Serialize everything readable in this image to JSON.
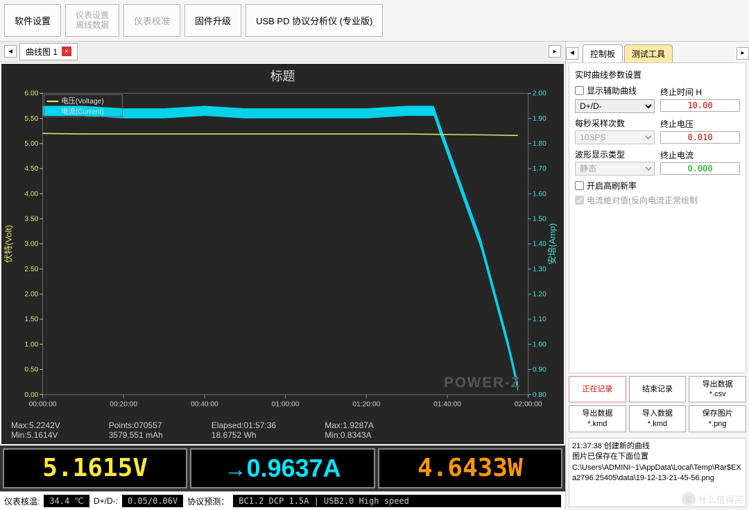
{
  "toolbar": {
    "b1": "软件设置",
    "b2a": "仪表设置",
    "b2b": "离线数据",
    "b3": "仪表校准",
    "b4": "固件升级",
    "b5": "USB PD 协议分析仪 (专业版)"
  },
  "mainTab": {
    "label": "曲线图 1"
  },
  "chart_data": {
    "type": "line",
    "title": "标题",
    "xlabel": "",
    "ylabel_left": "伏特(Volt)",
    "ylabel_right": "安培(Amp)",
    "legend": [
      "电压(Voltage)",
      "电流(Current)"
    ],
    "x_ticks": [
      "00:00:00",
      "00:20:00",
      "00:40:00",
      "01:00:00",
      "01:20:00",
      "01:40:00",
      "02:00:00"
    ],
    "y_left_ticks": [
      0.0,
      0.5,
      1.0,
      1.5,
      2.0,
      2.5,
      3.0,
      3.5,
      4.0,
      4.5,
      5.0,
      5.5,
      6.0
    ],
    "y_right_ticks": [
      0.8,
      0.9,
      1.0,
      1.1,
      1.2,
      1.3,
      1.4,
      1.5,
      1.6,
      1.7,
      1.8,
      1.9,
      2.0
    ],
    "xlim": [
      0,
      7200
    ],
    "ylim_left": [
      0,
      6
    ],
    "ylim_right": [
      0.8,
      2.0
    ],
    "series": [
      {
        "name": "电压(Voltage)",
        "color": "#e0e070",
        "axis": "left",
        "values": [
          [
            0,
            5.2
          ],
          [
            600,
            5.19
          ],
          [
            1200,
            5.19
          ],
          [
            1800,
            5.19
          ],
          [
            2400,
            5.19
          ],
          [
            3000,
            5.19
          ],
          [
            3600,
            5.19
          ],
          [
            4200,
            5.19
          ],
          [
            4800,
            5.19
          ],
          [
            5400,
            5.19
          ],
          [
            6000,
            5.18
          ],
          [
            6600,
            5.17
          ],
          [
            7047,
            5.16
          ]
        ]
      },
      {
        "name": "电流(Current)",
        "color": "#00e5ff",
        "axis": "right",
        "values": [
          [
            0,
            1.93
          ],
          [
            600,
            1.93
          ],
          [
            1200,
            1.92
          ],
          [
            1800,
            1.92
          ],
          [
            2400,
            1.93
          ],
          [
            3000,
            1.92
          ],
          [
            3600,
            1.92
          ],
          [
            4200,
            1.92
          ],
          [
            4800,
            1.92
          ],
          [
            5400,
            1.93
          ],
          [
            5800,
            1.93
          ],
          [
            5900,
            1.85
          ],
          [
            6100,
            1.7
          ],
          [
            6300,
            1.55
          ],
          [
            6500,
            1.4
          ],
          [
            6700,
            1.2
          ],
          [
            6900,
            1.0
          ],
          [
            7047,
            0.83
          ]
        ]
      }
    ],
    "watermark": "POWER-Z"
  },
  "info": {
    "max_v": "Max:5.2242V",
    "min_v": "Min:5.1614V",
    "points": "Points:070557",
    "mah": "3579.551 mAh",
    "elapsed": "Elapsed:01:57:36",
    "wh": "18.6752 Wh",
    "max_a": "Max:1.9287A",
    "min_a": "Min:0.8343A"
  },
  "readout": {
    "voltage": "5.1615V",
    "current": "0.9637A",
    "power": "4.6433W"
  },
  "status": {
    "temp_label": "仪表核温:",
    "temp": "34.4 ℃",
    "dpdm_label": "D+/D-:",
    "dpdm": "0.05/0.06V",
    "proto_label": "协议预测：",
    "proto": "BC1.2 DCP 1.5A | USB2.0 High speed"
  },
  "rightTabs": {
    "t1": "控制板",
    "t2": "测试工具"
  },
  "panel": {
    "heading": "实时曲线参数设置",
    "aux_label": "显示辅助曲线",
    "end_time_label": "终止时间 H",
    "end_time": "10.00",
    "d_sel": "D+/D-",
    "sps_label": "每秒采样次数",
    "sps": "10SPS",
    "endv_label": "终止电压",
    "endv": "0.010",
    "wave_label": "波形显示类型",
    "wave": "静态",
    "enda_label": "终止电流",
    "enda": "0.000",
    "hirate_label": "开启高刷新率",
    "abs_label": "电流绝对值(反向电流正常绘制"
  },
  "buttons": {
    "b1": "正在记录",
    "b2": "结束记录",
    "b3": "导出数据\n*.csv",
    "b4": "导出数据\n*.kmd",
    "b5": "导入数据\n*.kmd",
    "b6": "保存图片\n*.png"
  },
  "log": {
    "l1": "21:37:38 创建新的曲线",
    "l2": "图片已保存在下面位置",
    "l3": "C:\\Users\\ADMINI~1\\AppData\\Local\\Temp\\Rar$EXa2796.25405\\data\\19-12-13-21-45-56.png"
  },
  "brand": {
    "text": "什么值得买",
    "mark": "值"
  }
}
